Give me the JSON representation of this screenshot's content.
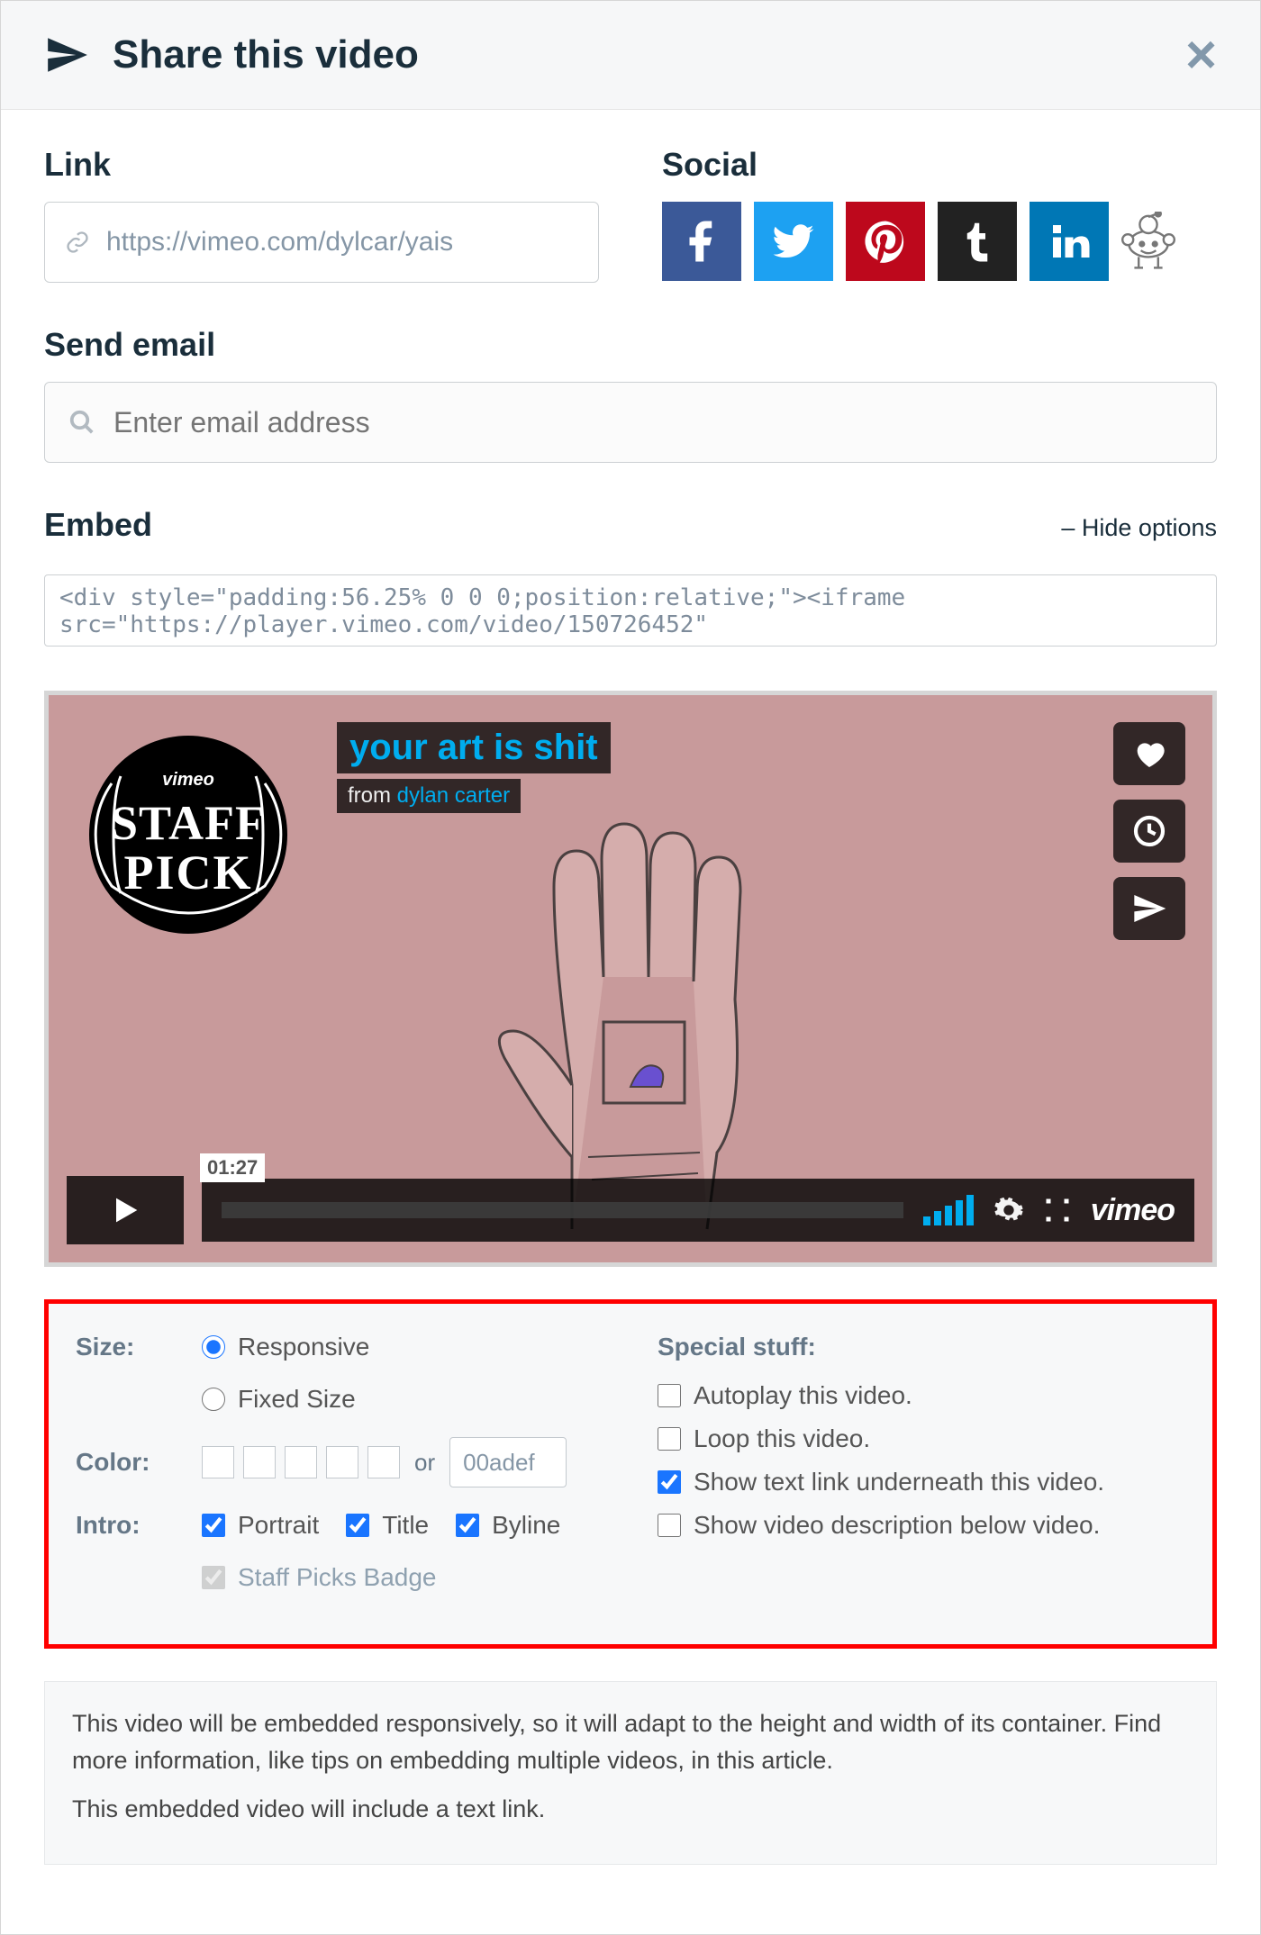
{
  "dialog": {
    "title": "Share this video"
  },
  "link": {
    "heading": "Link",
    "url": "https://vimeo.com/dylcar/yais"
  },
  "social": {
    "heading": "Social"
  },
  "email": {
    "heading": "Send email",
    "placeholder": "Enter email address"
  },
  "embed": {
    "heading": "Embed",
    "toggle": "– Hide options",
    "code": "<div style=\"padding:56.25% 0 0 0;position:relative;\"><iframe src=\"https://player.vimeo.com/video/150726452\""
  },
  "video": {
    "title": "your art is shit",
    "from_prefix": "from ",
    "author": "dylan carter",
    "duration": "01:27",
    "badge_top": "vimeo",
    "badge_line1": "STAFF",
    "badge_line2": "PICK",
    "brand": "vimeo"
  },
  "options": {
    "size_label": "Size:",
    "responsive": "Responsive",
    "fixed": "Fixed Size",
    "color_label": "Color:",
    "or": "or",
    "color_value": "00adef",
    "intro_label": "Intro:",
    "portrait": "Portrait",
    "title": "Title",
    "byline": "Byline",
    "staff_picks": "Staff Picks Badge",
    "special_heading": "Special stuff:",
    "autoplay": "Autoplay this video.",
    "loop": "Loop this video.",
    "textlink": "Show text link underneath this video.",
    "description": "Show video description below video."
  },
  "notes": {
    "line1": "This video will be embedded responsively, so it will adapt to the height and width of its container. Find more information, like tips on embedding multiple videos, in this article.",
    "line2": "This embedded video will include a text link."
  }
}
